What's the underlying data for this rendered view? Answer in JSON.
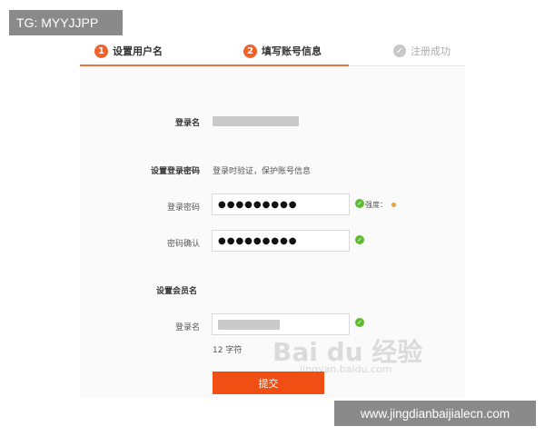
{
  "watermarks": {
    "top_left": "TG: MYYJJPP",
    "bottom_right": "www.jingdianbaijialecn.com",
    "center": "Bai du 经验",
    "center_sub": "jingyan.baidu.com"
  },
  "steps": [
    {
      "num": "1",
      "label": "设置用户名",
      "state": "active"
    },
    {
      "num": "2",
      "label": "填写账号信息",
      "state": "active"
    },
    {
      "num": "",
      "label": "注册成功",
      "state": "pending"
    }
  ],
  "login": {
    "label": "登录名"
  },
  "password_section": {
    "title": "设置登录密码",
    "hint": "登录时验证，保护账号信息",
    "password_label": "登录密码",
    "password_value": "●●●●●●●●●",
    "strength_label": "强度：",
    "confirm_label": "密码确认",
    "confirm_value": "●●●●●●●●●"
  },
  "member_section": {
    "title": "设置会员名",
    "username_label": "登录名",
    "char_hint": "12 字符"
  },
  "submit_label": "提交",
  "colors": {
    "accent": "#f0622a",
    "button": "#f04e12",
    "success": "#5bbd2b"
  }
}
